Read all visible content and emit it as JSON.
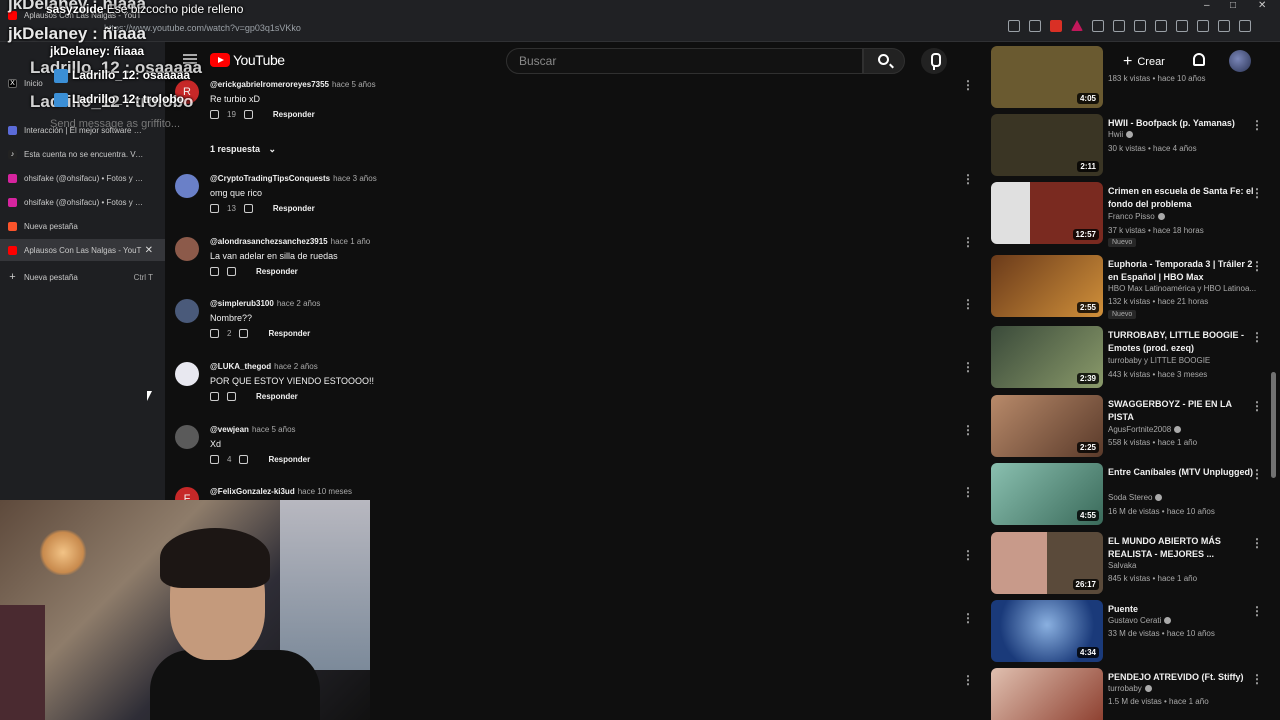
{
  "browser": {
    "url": "https://www.youtube.com/watch?v=gp03q1sVKko",
    "window_controls": [
      "–",
      "□",
      "✕"
    ]
  },
  "sidebar": {
    "tabs": [
      {
        "label": "Aplausos Con Las Nalgas - YouT",
        "favicon": "youtube-icon",
        "color": "#ff0000",
        "active": false
      },
      {
        "label": "Inicio",
        "favicon": "x-icon",
        "color": "#000000"
      },
      {
        "label": "Interacción | El mejor software para",
        "favicon": "app-icon",
        "color": "#5b6bd8"
      },
      {
        "label": "Esta cuenta no se encuentra. Ve a Ti",
        "favicon": "tiktok-icon",
        "color": "#222222"
      },
      {
        "label": "ohsifake (@ohsifacu) • Fotos y vide",
        "favicon": "instagram-icon",
        "color": "#d6249f"
      },
      {
        "label": "ohsifake (@ohsifacu) • Fotos y vide",
        "favicon": "instagram-icon",
        "color": "#d6249f"
      },
      {
        "label": "Nueva pestaña",
        "favicon": "brave-icon",
        "color": "#fb542b"
      },
      {
        "label": "Aplausos Con Las Nalgas - YouT",
        "favicon": "youtube-icon",
        "color": "#ff0000",
        "active": true
      }
    ],
    "new_tab": {
      "label": "Nueva pestaña",
      "shortcut": "Ctrl   T"
    }
  },
  "chat": {
    "lines": [
      {
        "user": "jkDelaney : ñiaaa",
        "size": 17,
        "color": "#ffffff"
      },
      {
        "user": "sasyzoide",
        "text": "Ese bizcocho pide relleno",
        "color": "#ffffff"
      },
      {
        "user": "jkDelaney: ñiaaa",
        "color": "#ffffff"
      },
      {
        "user": "Ladrillo_12 : osaaaaa",
        "color": "#ffffff"
      },
      {
        "user": "Ladrillo_12: osaaaaa",
        "color": "#ffffff"
      },
      {
        "user": "Ladrillo_12 : trolobo",
        "color": "#ffffff"
      },
      {
        "user": "Ladrillo_12: trolobo",
        "color": "#ffffff"
      }
    ],
    "input_placeholder": "Send message as griffito..."
  },
  "header": {
    "logo": "YouTube",
    "search_placeholder": "Buscar",
    "create_label": "Crear"
  },
  "comments": [
    {
      "author": "@erickgabrielromeroreyes7355",
      "time": "hace 5 años",
      "text": "Re turbio xD",
      "likes": "19",
      "reply": "Responder",
      "avatar_color": "#c62828",
      "avatar_letter": "R"
    },
    {
      "author": "@CryptoTradingTipsConquests",
      "time": "hace 3 años",
      "text": "omg que rico",
      "likes": "13",
      "reply": "Responder",
      "avatar_color": "#6a80c8"
    },
    {
      "author": "@alondrasanchezsanchez3915",
      "time": "hace 1 año",
      "text": "La van adelar en silla de ruedas",
      "likes": "",
      "reply": "Responder",
      "avatar_color": "#8c5a4a"
    },
    {
      "author": "@simplerub3100",
      "time": "hace 2 años",
      "text": "Nombre??",
      "likes": "2",
      "reply": "Responder",
      "avatar_color": "#4a5a7a"
    },
    {
      "author": "@LUKA_thegod",
      "time": "hace 2 años",
      "text": "POR QUE ESTOY VIENDO ESTOOOO!!",
      "likes": "",
      "reply": "Responder",
      "avatar_color": "#e8e8f0"
    },
    {
      "author": "@vewjean",
      "time": "hace 5 años",
      "text": "Xd",
      "likes": "4",
      "reply": "Responder",
      "avatar_color": "#5a5a5a"
    },
    {
      "author": "@FelixGonzalez-ki3ud",
      "time": "hace 10 meses",
      "text": "",
      "likes": "",
      "reply": "",
      "avatar_color": "#c62828",
      "avatar_letter": "F"
    }
  ],
  "replies_toggle": "1 respuesta",
  "suggestions": [
    {
      "title": "",
      "channel": "",
      "views": "183 k vistas • hace 10 años",
      "duration": "4:05",
      "verified": false,
      "new": false,
      "thumb": "#6a5a30"
    },
    {
      "title": "HWII - Boofpack (p. Yamanas)",
      "channel": "Hwii",
      "views": "30 k vistas • hace 4 años",
      "duration": "2:11",
      "verified": true,
      "new": false,
      "thumb": "#3a3524"
    },
    {
      "title": "Crimen en escuela de Santa Fe: el fondo del problema",
      "channel": "Franco Pisso",
      "views": "37 k vistas • hace 18 horas",
      "duration": "12:57",
      "verified": true,
      "new": true,
      "new_label": "Nuevo",
      "thumb": "#7a2a20"
    },
    {
      "title": "Euphoria - Temporada 3 | Tráiler 2 en Español | HBO Max",
      "channel": "HBO Max Latinoamérica y HBO Latinoa...",
      "views": "132 k vistas • hace 21 horas",
      "duration": "2:55",
      "verified": false,
      "new": true,
      "new_label": "Nuevo",
      "thumb": "#b0702a"
    },
    {
      "title": "TURROBABY, LITTLE BOOGIE - Emotes (prod. ezeq)",
      "channel": "turrobaby   y LITTLE BOOGIE",
      "views": "443 k vistas • hace 3 meses",
      "duration": "2:39",
      "verified": true,
      "new": false,
      "thumb": "#4a5a3a"
    },
    {
      "title": "SWAGGERBOYZ - PIE EN LA PISTA",
      "channel": "AgusFortnite2008",
      "views": "558 k vistas • hace 1 año",
      "duration": "2:25",
      "verified": true,
      "new": false,
      "thumb": "#8a5a4a"
    },
    {
      "title": "Entre Caníbales (MTV Unplugged)",
      "channel": "Soda Stereo",
      "views": "16 M de vistas • hace 10 años",
      "duration": "4:55",
      "verified": true,
      "new": false,
      "thumb": "#4a7a6a"
    },
    {
      "title": "EL MUNDO ABIERTO MÁS REALISTA - MEJORES ...",
      "channel": "Salvaka",
      "views": "845 k vistas • hace 1 año",
      "duration": "26:17",
      "verified": true,
      "new": false,
      "thumb": "#6a4a3a"
    },
    {
      "title": "Puente",
      "channel": "Gustavo Cerati",
      "views": "33 M de vistas • hace 10 años",
      "duration": "4:34",
      "verified": true,
      "new": false,
      "thumb": "#2a4a8a"
    },
    {
      "title": "PENDEJO ATREVIDO (Ft. Stiffy)",
      "channel": "turrobaby",
      "views": "1.5 M de vistas • hace 1 año",
      "duration": "",
      "verified": true,
      "new": false,
      "thumb": "#8a3a2a"
    }
  ],
  "colors": {
    "accent": "#ff0000",
    "bg": "#0f0f0f",
    "text_secondary": "#aaaaaa"
  }
}
